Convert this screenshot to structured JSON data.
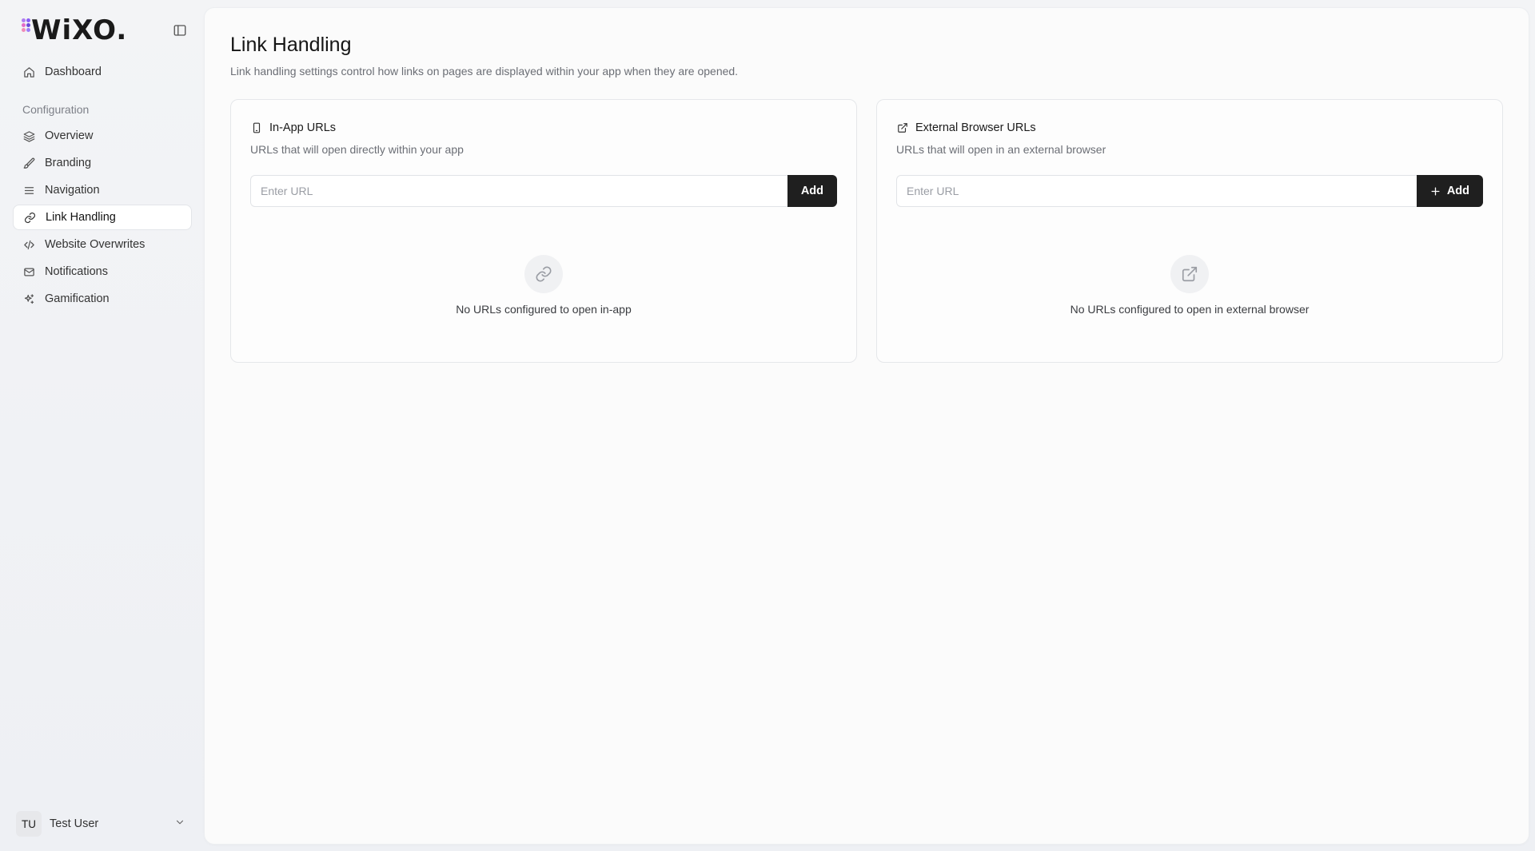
{
  "brand": {
    "logo_text": "WiXO.",
    "dot_colors": [
      "#b07cf0",
      "#8a5cf5",
      "#e46bc9",
      "#6a49d9",
      "#f08bb8",
      "#9d7cf7"
    ]
  },
  "sidebar": {
    "top_items": [
      {
        "label": "Dashboard",
        "icon": "home-icon"
      }
    ],
    "section_label": "Configuration",
    "items": [
      {
        "label": "Overview",
        "icon": "layers-icon"
      },
      {
        "label": "Branding",
        "icon": "brush-icon"
      },
      {
        "label": "Navigation",
        "icon": "menu-icon"
      },
      {
        "label": "Link Handling",
        "icon": "link-icon",
        "active": true
      },
      {
        "label": "Website Overwrites",
        "icon": "code-icon"
      },
      {
        "label": "Notifications",
        "icon": "mail-icon"
      },
      {
        "label": "Gamification",
        "icon": "sparkles-icon"
      }
    ],
    "user": {
      "initials": "TU",
      "name": "Test User"
    }
  },
  "main": {
    "title": "Link Handling",
    "description": "Link handling settings control how links on pages are displayed within your app when they are opened.",
    "cards": [
      {
        "title": "In-App URLs",
        "icon": "smartphone-icon",
        "subtitle": "URLs that will open directly within your app",
        "input_placeholder": "Enter URL",
        "button_label": "Add",
        "empty_icon": "link-icon",
        "empty_text": "No URLs configured to open in-app"
      },
      {
        "title": "External Browser URLs",
        "icon": "external-link-icon",
        "subtitle": "URLs that will open in an external browser",
        "input_placeholder": "Enter URL",
        "button_label": "Add",
        "empty_icon": "external-link-icon",
        "empty_text": "No URLs configured to open in external browser"
      }
    ]
  },
  "colors": {
    "accent_button": "#1f1f1f",
    "muted_text": "#6b6e75"
  }
}
